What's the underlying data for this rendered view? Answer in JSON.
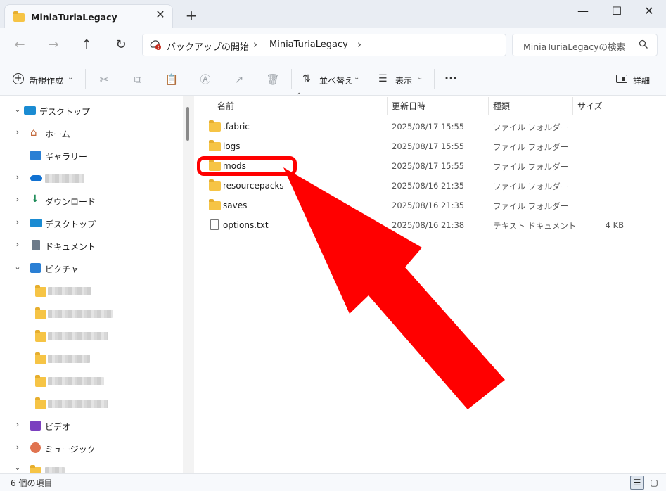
{
  "window": {
    "tab_title": "MiniaTuriaLegacy",
    "tab_icon": "folder-icon",
    "new_tab_glyph": "+",
    "close_glyph": "✕",
    "minimize_glyph": "—",
    "maximize_glyph": "☐",
    "window_close_glyph": "✕"
  },
  "address": {
    "crumbs": [
      "バックアップの開始",
      "MiniaTuriaLegacy"
    ],
    "search_placeholder": "MiniaTuriaLegacyの検索"
  },
  "toolbar": {
    "new_label": "新規作成",
    "sort_label": "並べ替え",
    "view_label": "表示",
    "more_label": "···",
    "details_label": "詳細"
  },
  "sidebar": {
    "items": [
      {
        "label": "デスクトップ",
        "chevron": "⌄",
        "icon": "desktop-icon"
      },
      {
        "label": "ホーム",
        "chevron": "›",
        "icon": "home-icon"
      },
      {
        "label": "ギャラリー",
        "chevron": "",
        "icon": "gallery-icon"
      },
      {
        "label": "",
        "chevron": "›",
        "icon": "onedrive-icon"
      },
      {
        "label": "ダウンロード",
        "chevron": "›",
        "icon": "download-icon"
      },
      {
        "label": "デスクトップ",
        "chevron": "›",
        "icon": "desktop-icon"
      },
      {
        "label": "ドキュメント",
        "chevron": "›",
        "icon": "document-icon"
      },
      {
        "label": "ピクチャ",
        "chevron": "⌄",
        "icon": "pictures-icon"
      },
      {
        "label": "ビデオ",
        "chevron": "›",
        "icon": "video-icon"
      },
      {
        "label": "ミュージック",
        "chevron": "›",
        "icon": "music-icon"
      }
    ]
  },
  "columns": {
    "name": "名前",
    "date": "更新日時",
    "type": "種類",
    "size": "サイズ"
  },
  "files": [
    {
      "name": ".fabric",
      "date": "2025/08/17 15:55",
      "type": "ファイル フォルダー",
      "size": "",
      "icon": "folder-icon"
    },
    {
      "name": "logs",
      "date": "2025/08/17 15:55",
      "type": "ファイル フォルダー",
      "size": "",
      "icon": "folder-icon"
    },
    {
      "name": "mods",
      "date": "2025/08/17 15:55",
      "type": "ファイル フォルダー",
      "size": "",
      "icon": "folder-icon"
    },
    {
      "name": "resourcepacks",
      "date": "2025/08/16 21:35",
      "type": "ファイル フォルダー",
      "size": "",
      "icon": "folder-icon"
    },
    {
      "name": "saves",
      "date": "2025/08/16 21:35",
      "type": "ファイル フォルダー",
      "size": "",
      "icon": "folder-icon"
    },
    {
      "name": "options.txt",
      "date": "2025/08/16 21:38",
      "type": "テキスト ドキュメント",
      "size": "4 KB",
      "icon": "text-file-icon"
    }
  ],
  "status": {
    "count_text": "6 個の項目"
  },
  "colors": {
    "highlight": "#ff0000",
    "folder": "#f6c445"
  }
}
